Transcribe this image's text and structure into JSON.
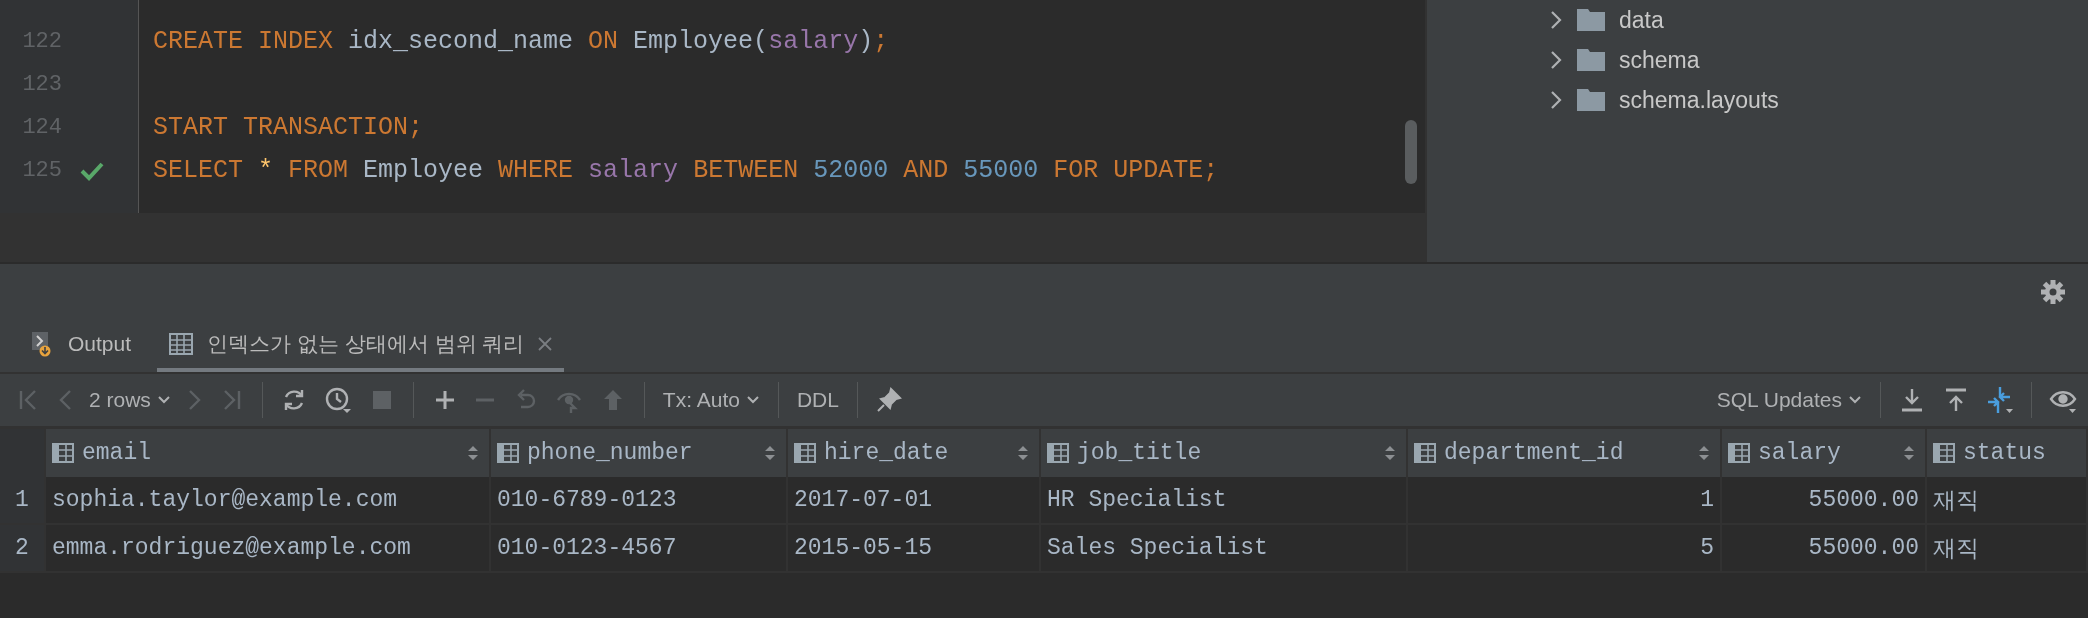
{
  "editor": {
    "lines": [
      {
        "number": "122",
        "check": false,
        "tokens": [
          {
            "kind": "keyword",
            "text": "CREATE INDEX"
          },
          {
            "kind": "ident",
            "text": " idx_second_name "
          },
          {
            "kind": "keyword",
            "text": "ON"
          },
          {
            "kind": "ident",
            "text": " Employee("
          },
          {
            "kind": "column",
            "text": "salary"
          },
          {
            "kind": "ident",
            "text": ")"
          },
          {
            "kind": "keyword",
            "text": ";"
          }
        ]
      },
      {
        "number": "123",
        "check": false
      },
      {
        "number": "124",
        "check": false,
        "tokens": [
          {
            "kind": "keyword",
            "text": "START TRANSACTION;"
          }
        ]
      },
      {
        "number": "125",
        "check": true,
        "tokens": [
          {
            "kind": "keyword",
            "text": "SELECT "
          },
          {
            "kind": "star",
            "text": "*"
          },
          {
            "kind": "keyword",
            "text": " FROM "
          },
          {
            "kind": "ident",
            "text": "Employee "
          },
          {
            "kind": "keyword",
            "text": "WHERE "
          },
          {
            "kind": "column",
            "text": "salary "
          },
          {
            "kind": "keyword",
            "text": "BETWEEN "
          },
          {
            "kind": "number",
            "text": "52000"
          },
          {
            "kind": "keyword",
            "text": " AND "
          },
          {
            "kind": "number",
            "text": "55000"
          },
          {
            "kind": "keyword",
            "text": " FOR UPDATE;"
          }
        ]
      }
    ]
  },
  "project_tree": {
    "items": [
      {
        "label": "data",
        "expanded": false
      },
      {
        "label": "schema",
        "expanded": false
      },
      {
        "label": "schema.layouts",
        "expanded": false
      }
    ]
  },
  "tabs": [
    {
      "kind": "output",
      "label": "Output",
      "selected": false,
      "closable": false
    },
    {
      "kind": "table",
      "label": "인덱스가 없는 상태에서 범위 쿼리",
      "selected": true,
      "closable": true
    }
  ],
  "toolbar": {
    "left_groups": [
      [
        {
          "kind": "first",
          "disabled": true
        },
        {
          "kind": "prev",
          "disabled": true
        },
        {
          "kind": "dropdown",
          "label": "2 rows",
          "disabled": false
        },
        {
          "kind": "next",
          "disabled": true
        },
        {
          "kind": "last",
          "disabled": true
        }
      ],
      [
        {
          "kind": "refresh",
          "disabled": false
        },
        {
          "kind": "history",
          "disabled": false
        },
        {
          "kind": "stop",
          "disabled": true
        }
      ],
      [
        {
          "kind": "add",
          "disabled": false
        },
        {
          "kind": "remove",
          "disabled": true
        },
        {
          "kind": "revert",
          "disabled": true
        },
        {
          "kind": "view",
          "disabled": true
        },
        {
          "kind": "submit",
          "disabled": true
        }
      ],
      [
        {
          "kind": "dropdown",
          "label": "Tx: Auto",
          "disabled": false
        }
      ],
      [
        {
          "kind": "text",
          "label": "DDL",
          "disabled": false
        }
      ],
      [
        {
          "kind": "pin",
          "disabled": false
        }
      ]
    ],
    "right_groups": [
      [
        {
          "kind": "dropdown",
          "label": "SQL Updates",
          "disabled": false
        }
      ],
      [
        {
          "kind": "download",
          "disabled": false
        },
        {
          "kind": "upload",
          "disabled": false
        },
        {
          "kind": "compare",
          "disabled": false
        }
      ],
      [
        {
          "kind": "eye",
          "disabled": false
        }
      ]
    ]
  },
  "table": {
    "columns": [
      {
        "name": "email",
        "numeric": false,
        "sortable": true
      },
      {
        "name": "phone_number",
        "numeric": false,
        "sortable": true
      },
      {
        "name": "hire_date",
        "numeric": false,
        "sortable": true
      },
      {
        "name": "job_title",
        "numeric": false,
        "sortable": true
      },
      {
        "name": "department_id",
        "numeric": true,
        "sortable": true
      },
      {
        "name": "salary",
        "numeric": true,
        "sortable": true
      },
      {
        "name": "status",
        "numeric": false,
        "sortable": false
      }
    ],
    "rows": [
      {
        "number": "1",
        "cells": [
          "sophia.taylor@example.com",
          "010-6789-0123",
          "2017-07-01",
          "HR Specialist",
          "1",
          "55000.00",
          "재직"
        ]
      },
      {
        "number": "2",
        "cells": [
          "emma.rodriguez@example.com",
          "010-0123-4567",
          "2015-05-15",
          "Sales Specialist",
          "5",
          "55000.00",
          "재직"
        ]
      }
    ]
  }
}
